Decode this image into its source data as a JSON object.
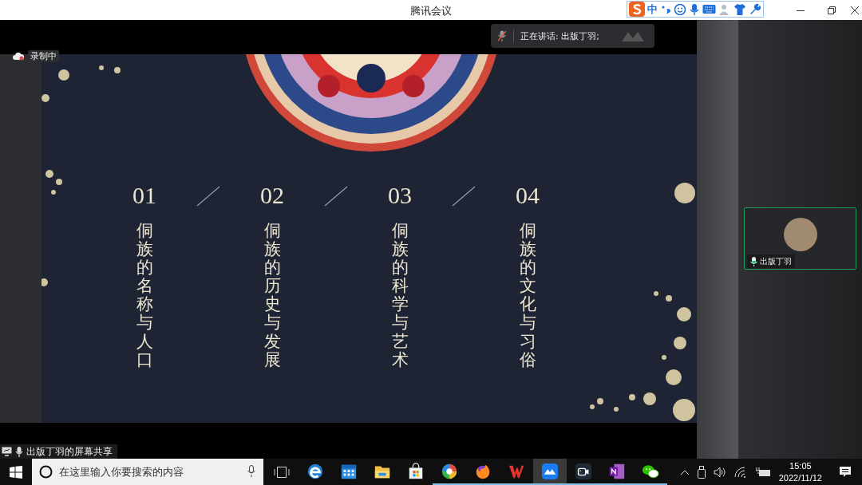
{
  "window": {
    "title": "腾讯会议"
  },
  "ime_toolbar": {
    "mode": "中"
  },
  "recording": {
    "label": "录制中"
  },
  "speaker_toast": {
    "text": "正在讲话: 出版丁羽;",
    "mic_muted": true
  },
  "slide": {
    "sections": [
      {
        "number": "01",
        "title": "侗族的名称与人口"
      },
      {
        "number": "02",
        "title": "侗族的历史与发展"
      },
      {
        "number": "03",
        "title": "侗族的科学与艺术"
      },
      {
        "number": "04",
        "title": "侗族的文化与习俗"
      }
    ]
  },
  "share_label": {
    "text": "出版丁羽的屏幕共享"
  },
  "participant": {
    "name": "出版丁羽",
    "speaking": true
  },
  "taskbar": {
    "search": {
      "placeholder": "在这里输入你要搜索的内容"
    },
    "apps": [
      {
        "kind": "edge",
        "running": false,
        "selected": false
      },
      {
        "kind": "calendar",
        "running": false,
        "selected": false
      },
      {
        "kind": "folder",
        "running": false,
        "selected": false
      },
      {
        "kind": "store",
        "running": false,
        "selected": false
      },
      {
        "kind": "pinwheel",
        "running": true,
        "selected": false
      },
      {
        "kind": "firefox",
        "running": true,
        "selected": false
      },
      {
        "kind": "wps",
        "running": true,
        "selected": false
      },
      {
        "kind": "meeting",
        "running": true,
        "selected": true
      },
      {
        "kind": "camera",
        "running": true,
        "selected": false
      },
      {
        "kind": "onenote",
        "running": true,
        "selected": false
      },
      {
        "kind": "wechat",
        "running": true,
        "selected": false
      }
    ],
    "clock": {
      "time": "15:05",
      "date": "2022/11/12"
    }
  }
}
